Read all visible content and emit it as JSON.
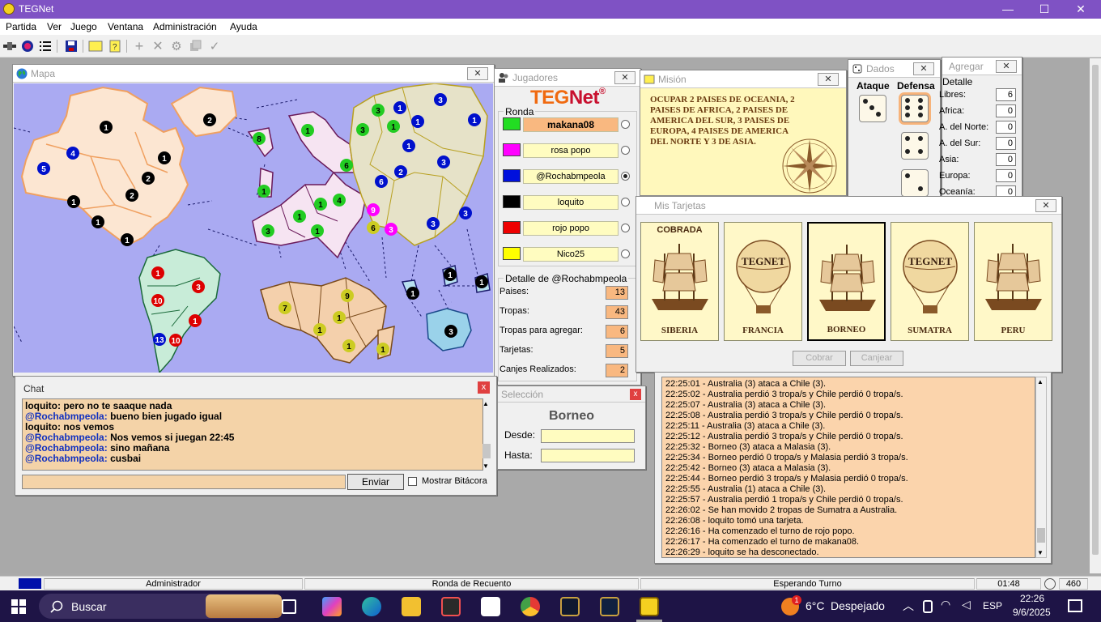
{
  "app": {
    "title": "TEGNet"
  },
  "window_controls": {
    "minimize": "—",
    "maximize": "☐",
    "close": "✕"
  },
  "menu": [
    "Partida",
    "Ver",
    "Juego",
    "Ventana",
    "Administración",
    "Ayuda"
  ],
  "toolbar": {
    "icons": [
      "connect-icon",
      "start-icon",
      "list-icon",
      "save-icon",
      "card-icon",
      "mission-icon",
      "add-icon",
      "remove-icon",
      "settings-icon",
      "copy-icon",
      "check-icon"
    ]
  },
  "map": {
    "title": "Mapa",
    "close": "✕",
    "armies": [
      "1",
      "2",
      "4",
      "5",
      "1",
      "2",
      "1",
      "1",
      "1",
      "2",
      "2",
      "1",
      "1",
      "8",
      "6",
      "3",
      "1",
      "1",
      "1",
      "1",
      "1",
      "3",
      "3",
      "1",
      "3",
      "1",
      "3",
      "2",
      "1",
      "4",
      "6",
      "3",
      "1",
      "3",
      "3",
      "1",
      "9",
      "1",
      "3",
      "1",
      "6",
      "10",
      "1",
      "10",
      "13",
      "7",
      "9",
      "1",
      "1",
      "1",
      "1",
      "1",
      "1",
      "3",
      "3",
      "1"
    ]
  },
  "players": {
    "title": "Jugadores",
    "logo_teg": "TEG",
    "logo_net": "Net",
    "logo_reg": "®",
    "group_label": "Ronda",
    "list": [
      {
        "name": "makana08",
        "color": "#22dd22",
        "active": false
      },
      {
        "name": "rosa popo",
        "color": "#ff00ff",
        "active": false
      },
      {
        "name": "@Rochabmpeola",
        "color": "#0010dd",
        "active": true
      },
      {
        "name": "loquito",
        "color": "#000000",
        "active": false
      },
      {
        "name": "rojo popo",
        "color": "#ee0000",
        "active": false
      },
      {
        "name": "Nico25",
        "color": "#ffff00",
        "active": false
      }
    ],
    "detail_title": "Detalle de @Rochabmpeola",
    "detail": [
      {
        "label": "Paises:",
        "value": "13"
      },
      {
        "label": "Tropas:",
        "value": "43"
      },
      {
        "label": "Tropas para agregar:",
        "value": "6"
      },
      {
        "label": "Tarjetas:",
        "value": "5"
      },
      {
        "label": "Canjes Realizados:",
        "value": "2"
      }
    ]
  },
  "mission": {
    "title": "Misión",
    "text": "OCUPAR 2 PAISES DE OCEANIA, 2 PAISES DE AFRICA, 2 PAISES DE AMERICA DEL SUR, 3 PAISES DE EUROPA, 4 PAISES DE AMERICA DEL NORTE Y 3 DE ASIA."
  },
  "dice": {
    "title": "Dados",
    "attack_label": "Ataque",
    "defense_label": "Defensa",
    "attack": [
      3
    ],
    "defense": [
      6,
      4,
      2
    ]
  },
  "add": {
    "title": "Agregar",
    "detail_label": "Detalle",
    "rows": [
      {
        "label": "Libres:",
        "value": "6"
      },
      {
        "label": "Africa:",
        "value": "0"
      },
      {
        "label": "A. del Norte:",
        "value": "0"
      },
      {
        "label": "A. del Sur:",
        "value": "0"
      },
      {
        "label": "Asia:",
        "value": "0"
      },
      {
        "label": "Europa:",
        "value": "0"
      },
      {
        "label": "Oceanía:",
        "value": "0"
      }
    ]
  },
  "cards": {
    "title": "Mis Tarjetas",
    "close": "✕",
    "list": [
      {
        "name": "SIBERIA",
        "type": "ship",
        "status": "COBRADA"
      },
      {
        "name": "FRANCIA",
        "type": "balloon",
        "status": ""
      },
      {
        "name": "BORNEO",
        "type": "ship",
        "status": ""
      },
      {
        "name": "SUMATRA",
        "type": "balloon",
        "status": ""
      },
      {
        "name": "PERU",
        "type": "ship",
        "status": ""
      }
    ],
    "balloon_text": "TEGNET",
    "cobrar_label": "Cobrar",
    "canjear_label": "Canjear"
  },
  "log": {
    "lines": [
      "22:25:01 - Australia (3) ataca a Chile (3).",
      "22:25:02 - Australia perdió 3 tropa/s y Chile perdió 0 tropa/s.",
      "22:25:07 - Australia (3) ataca a Chile (3).",
      "22:25:08 - Australia perdió 3 tropa/s y Chile perdió 0 tropa/s.",
      "22:25:11 - Australia (3) ataca a Chile (3).",
      "22:25:12 - Australia perdió 3 tropa/s y Chile perdió 0 tropa/s.",
      "22:25:32 - Borneo (3) ataca a Malasia (3).",
      "22:25:34 - Borneo perdió 0 tropa/s y Malasia perdió 3 tropa/s.",
      "22:25:42 - Borneo (3) ataca a Malasia (3).",
      "22:25:44 - Borneo perdió 3 tropa/s y Malasia perdió 0 tropa/s.",
      "22:25:55 - Australia (1) ataca a Chile (3).",
      "22:25:57 - Australia perdió 1 tropa/s y Chile perdió 0 tropa/s.",
      "22:26:02 - Se han movido 2 tropas de Sumatra a Australia.",
      "22:26:08 - loquito tomó una tarjeta.",
      "22:26:16 - Ha comenzado el turno de rojo popo.",
      "22:26:17 - Ha comenzado el turno de makana08.",
      "22:26:29 - loquito se ha desconectado."
    ]
  },
  "chat": {
    "title": "Chat",
    "close": "x",
    "lines": [
      {
        "nick": "loquito",
        "text": "pero no te saaque nada"
      },
      {
        "nick": "@Rochabmpeola",
        "text": "bueno bien jugado igual"
      },
      {
        "nick": "loquito",
        "text": "nos vemos"
      },
      {
        "nick": "@Rochabmpeola",
        "text": "Nos vemos si juegan 22:45"
      },
      {
        "nick": "@Rochabmpeola",
        "text": "sino mañana"
      },
      {
        "nick": "@Rochabmpeola",
        "text": "cusbai"
      }
    ],
    "input_value": "",
    "send_label": "Enviar",
    "log_label": "Mostrar Bitácora"
  },
  "selection": {
    "title": "Selección",
    "close": "x",
    "country": "Borneo",
    "from_label": "Desde:",
    "to_label": "Hasta:",
    "from_value": "",
    "to_value": ""
  },
  "status": {
    "role": "Administrador",
    "phase": "Ronda de Recuento",
    "state": "Esperando Turno",
    "time": "01:48",
    "value": "460"
  },
  "taskbar": {
    "search_placeholder": "Buscar",
    "weather_temp": "6°C",
    "weather_text": "Despejado",
    "weather_badge": "1",
    "lang": "ESP",
    "time": "22:26",
    "date": "9/6/2025"
  },
  "colors": {
    "title_purple": "#7f52c4",
    "panel_peach": "#f4d3a8",
    "map_sea": "#aaaaf2",
    "log_bg": "#fbd4ac"
  }
}
